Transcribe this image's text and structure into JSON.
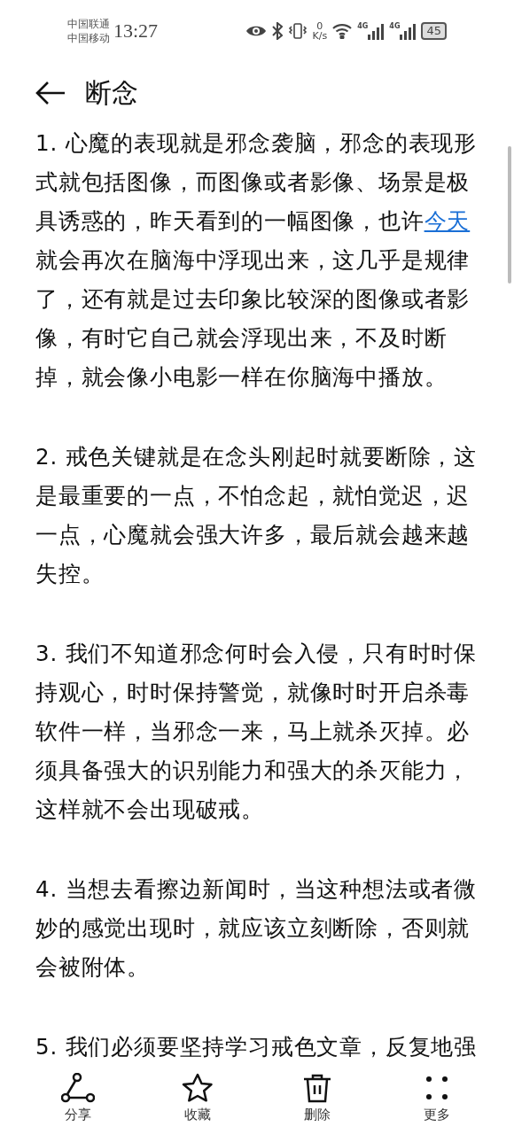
{
  "status_bar": {
    "carriers": [
      "中国联通",
      "中国移动"
    ],
    "time": "13:27",
    "speed_value": "0",
    "speed_unit": "K/s",
    "network_labels": [
      "4G",
      "4G"
    ],
    "battery": "45"
  },
  "header": {
    "title": "断念"
  },
  "paragraphs": [
    {
      "parts": [
        {
          "kind": "text",
          "text": "1. 心魔的表现就是邪念袭脑，邪念的表现形式就包括图像，而图像或者影像、场景是极具诱惑的，昨天看到的一幅图像，也许"
        },
        {
          "kind": "link",
          "text": "今天"
        },
        {
          "kind": "text",
          "text": "就会再次在脑海中浮现出来，这几乎是规律了，还有就是过去印象比较深的图像或者影像，有时它自己就会浮现出来，不及时断掉，就会像小电影一样在你脑海中播放。"
        }
      ]
    },
    {
      "parts": [
        {
          "kind": "text",
          "text": "2. 戒色关键就是在念头刚起时就要断除，这是最重要的一点，不怕念起，就怕觉迟，迟一点，心魔就会强大许多，最后就会越来越失控。"
        }
      ]
    },
    {
      "parts": [
        {
          "kind": "text",
          "text": "3. 我们不知道邪念何时会入侵，只有时时保持观心，时时保持警觉，就像时时开启杀毒软件一样，当邪念一来，马上就杀灭掉。必须具备强大的识别能力和强大的杀灭能力，这样就不会出现破戒。"
        }
      ]
    },
    {
      "parts": [
        {
          "kind": "text",
          "text": "4. 当想去看擦边新闻时，当这种想法或者微妙的感觉出现时，就应该立刻断除，否则就会被附体。"
        }
      ]
    },
    {
      "parts": [
        {
          "kind": "text",
          "text": "5. 我们必须要坚持学习戒色文章，反复地强"
        }
      ]
    }
  ],
  "toolbar": [
    {
      "kind": "share",
      "label": "分享"
    },
    {
      "kind": "star",
      "label": "收藏"
    },
    {
      "kind": "trash",
      "label": "删除"
    },
    {
      "kind": "more",
      "label": "更多"
    }
  ]
}
